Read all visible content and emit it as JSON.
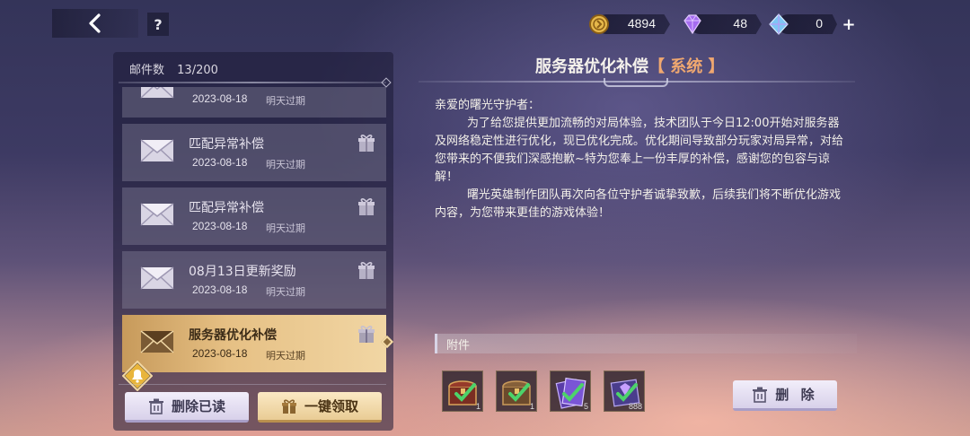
{
  "topbar": {
    "help_label": "?",
    "currencies": [
      {
        "name": "gold-coin",
        "value": "4894",
        "color": "#e6b84a"
      },
      {
        "name": "purple-diamond",
        "value": "48",
        "color": "#a56cf0"
      },
      {
        "name": "blue-crystal",
        "value": "0",
        "color": "#7ec6f5"
      }
    ],
    "plus_label": "+"
  },
  "mailbox": {
    "count_label": "邮件数",
    "count_value": "13/200",
    "items": [
      {
        "title": "",
        "date": "2023-08-18",
        "expire": "明天过期",
        "selected": false
      },
      {
        "title": "匹配异常补偿",
        "date": "2023-08-18",
        "expire": "明天过期",
        "selected": false
      },
      {
        "title": "匹配异常补偿",
        "date": "2023-08-18",
        "expire": "明天过期",
        "selected": false
      },
      {
        "title": "08月13日更新奖励",
        "date": "2023-08-18",
        "expire": "明天过期",
        "selected": false
      },
      {
        "title": "服务器优化补偿",
        "date": "2023-08-18",
        "expire": "明天过期",
        "selected": true
      }
    ],
    "delete_read_label": "删除已读",
    "claim_all_label": "一键领取"
  },
  "mail": {
    "subject": "服务器优化补偿",
    "category": "【 系统 】",
    "greeting": "亲爱的曙光守护者：",
    "paragraph1": "为了给您提供更加流畅的对局体验，技术团队于今日12:00开始对服务器及网络稳定性进行优化，现已优化完成。优化期间导致部分玩家对局异常，对给您带来的不便我们深感抱歉~特为您奉上一份丰厚的补偿，感谢您的包容与谅解！",
    "paragraph2": "曙光英雄制作团队再次向各位守护者诚挚致歉，后续我们将不断优化游戏内容，为您带来更佳的游戏体验！",
    "attachments_label": "附件",
    "attachments": [
      {
        "icon": "treasure-chest-red",
        "count": "1"
      },
      {
        "icon": "treasure-chest-brown",
        "count": "1"
      },
      {
        "icon": "purple-card-pack",
        "count": "5"
      },
      {
        "icon": "purple-gem-pack",
        "count": "888"
      }
    ],
    "delete_label": "删 除"
  }
}
